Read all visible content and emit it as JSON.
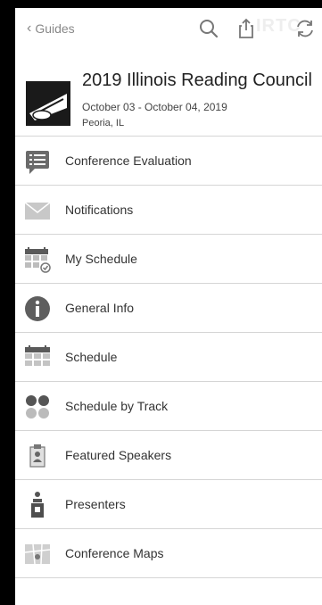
{
  "topbar": {
    "back_label": "Guides",
    "watermark": "IRTC"
  },
  "event": {
    "title": "2019 Illinois Reading Council",
    "dates": "October 03 - October 04, 2019",
    "location": "Peoria, IL"
  },
  "menu": [
    {
      "label": "Conference Evaluation",
      "icon": "evaluation-icon"
    },
    {
      "label": "Notifications",
      "icon": "envelope-icon"
    },
    {
      "label": "My Schedule",
      "icon": "my-schedule-icon"
    },
    {
      "label": "General Info",
      "icon": "info-icon"
    },
    {
      "label": "Schedule",
      "icon": "calendar-icon"
    },
    {
      "label": "Schedule by Track",
      "icon": "track-dots-icon"
    },
    {
      "label": "Featured Speakers",
      "icon": "speaker-badge-icon"
    },
    {
      "label": "Presenters",
      "icon": "podium-icon"
    },
    {
      "label": "Conference Maps",
      "icon": "map-icon"
    }
  ]
}
